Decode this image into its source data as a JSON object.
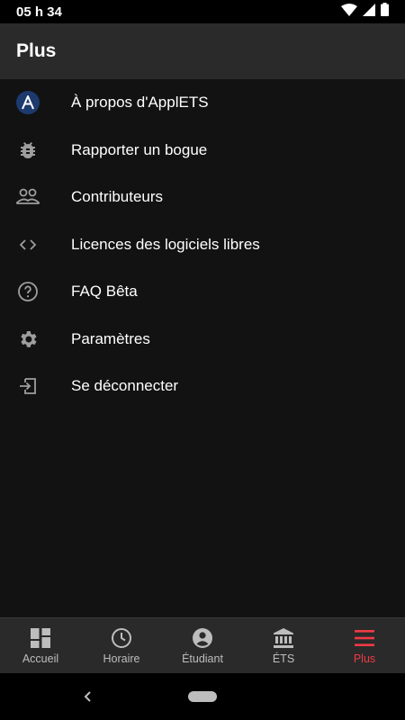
{
  "status_bar": {
    "time": "05 h 34"
  },
  "header": {
    "title": "Plus"
  },
  "menu": {
    "items": [
      {
        "label": "À propos d'ApplETS",
        "icon": "applets-logo-icon"
      },
      {
        "label": "Rapporter un bogue",
        "icon": "bug-icon"
      },
      {
        "label": "Contributeurs",
        "icon": "people-icon"
      },
      {
        "label": "Licences des logiciels libres",
        "icon": "code-icon"
      },
      {
        "label": "FAQ Bêta",
        "icon": "help-icon"
      },
      {
        "label": "Paramètres",
        "icon": "gear-icon"
      },
      {
        "label": "Se déconnecter",
        "icon": "logout-icon"
      }
    ]
  },
  "bottom_nav": {
    "items": [
      {
        "label": "Accueil",
        "icon": "dashboard-icon"
      },
      {
        "label": "Horaire",
        "icon": "clock-icon"
      },
      {
        "label": "Étudiant",
        "icon": "account-icon"
      },
      {
        "label": "ÉTS",
        "icon": "bank-icon"
      },
      {
        "label": "Plus",
        "icon": "menu-icon"
      }
    ],
    "active": "Plus"
  },
  "colors": {
    "background": "#121212",
    "app_bar": "#2a2a2a",
    "accent": "#ef3b45",
    "icon_gray": "#9e9e9e"
  }
}
